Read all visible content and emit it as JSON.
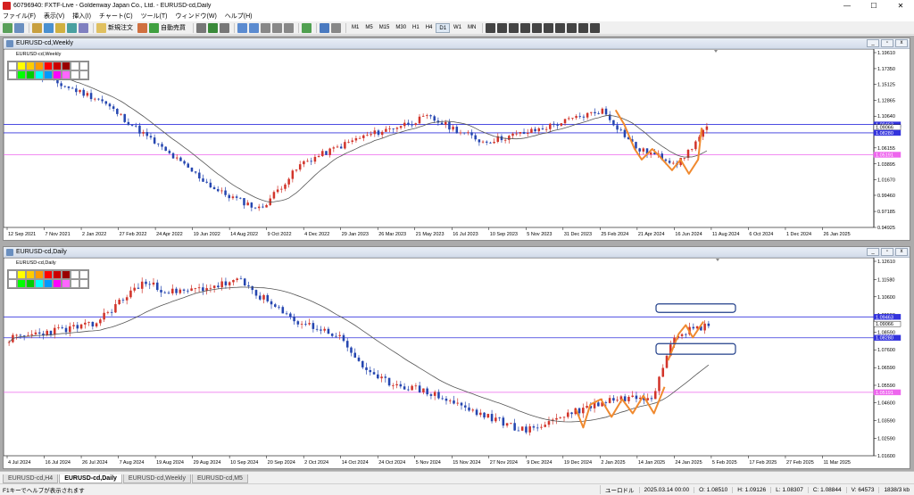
{
  "window": {
    "title": "60796940: FXTF-Live - Goldenway Japan Co., Ltd. - EURUSD-cd,Daily",
    "min": "—",
    "max": "☐",
    "close": "✕"
  },
  "menu": [
    "ファイル(F)",
    "表示(V)",
    "挿入(I)",
    "チャート(C)",
    "ツール(T)",
    "ウィンドウ(W)",
    "ヘルプ(H)"
  ],
  "toolbar": {
    "new_order": "新規注文",
    "auto_trade": "自動売買",
    "timeframes": [
      "M1",
      "M5",
      "M15",
      "M30",
      "H1",
      "H4",
      "D1",
      "W1",
      "MN"
    ],
    "active_timeframe": "D1"
  },
  "colors": {
    "bull": "#d2342a",
    "bear": "#2546b0",
    "ma": "#555555",
    "hline_blue": "#3333dd",
    "hline_pink": "#ee66ee",
    "orange": "#f08a30",
    "box": "#213f8a"
  },
  "charts": [
    {
      "name": "EURUSD-cd,Weekly",
      "label": "EURUSD-cd,Weekly",
      "y_ticks": [
        "1.19610",
        "1.17350",
        "1.15125",
        "1.12865",
        "1.10640",
        "1.08380",
        "1.06155",
        "1.03895",
        "1.01670",
        "0.99460",
        "0.97185",
        "0.94925"
      ],
      "price_tags": [
        {
          "text": "1.09463",
          "bg": "#3333dd",
          "fg": "#fff",
          "value": 1.09463
        },
        {
          "text": "1.09066",
          "bg": "#ffffff",
          "fg": "#000",
          "value": 1.09066
        },
        {
          "text": "1.08280",
          "bg": "#3333dd",
          "fg": "#fff",
          "value": 1.0828
        },
        {
          "text": "1.05191",
          "bg": "#ee66ee",
          "fg": "#fff",
          "value": 1.05191
        }
      ],
      "x_labels": [
        "12 Sep 2021",
        "7 Nov 2021",
        "2 Jan 2022",
        "27 Feb 2022",
        "24 Apr 2022",
        "19 Jun 2022",
        "14 Aug 2022",
        "9 Oct 2022",
        "4 Dec 2022",
        "29 Jan 2023",
        "26 Mar 2023",
        "21 May 2023",
        "16 Jul 2023",
        "10 Sep 2023",
        "5 Nov 2023",
        "31 Dec 2023",
        "25 Feb 2024",
        "21 Apr 2024",
        "16 Jun 2024",
        "11 Aug 2024",
        "6 Oct 2024",
        "1 Dec 2024",
        "26 Jan 2025"
      ]
    },
    {
      "name": "EURUSD-cd,Daily",
      "label": "EURUSD-cd,Daily",
      "y_ticks": [
        "1.12610",
        "1.11580",
        "1.10600",
        "1.09590",
        "1.08590",
        "1.07600",
        "1.06590",
        "1.05590",
        "1.04600",
        "1.03590",
        "1.02590",
        "1.01600"
      ],
      "price_tags": [
        {
          "text": "1.09463",
          "bg": "#3333dd",
          "fg": "#fff",
          "value": 1.09463
        },
        {
          "text": "1.09066",
          "bg": "#ffffff",
          "fg": "#000",
          "value": 1.09066
        },
        {
          "text": "1.08280",
          "bg": "#3333dd",
          "fg": "#fff",
          "value": 1.0828
        },
        {
          "text": "1.05191",
          "bg": "#ee66ee",
          "fg": "#fff",
          "value": 1.05191
        }
      ],
      "x_labels": [
        "4 Jul 2024",
        "16 Jul 2024",
        "26 Jul 2024",
        "7 Aug 2024",
        "19 Aug 2024",
        "29 Aug 2024",
        "10 Sep 2024",
        "20 Sep 2024",
        "2 Oct 2024",
        "14 Oct 2024",
        "24 Oct 2024",
        "5 Nov 2024",
        "15 Nov 2024",
        "27 Nov 2024",
        "9 Dec 2024",
        "19 Dec 2024",
        "2 Jan 2025",
        "14 Jan 2025",
        "24 Jan 2025",
        "5 Feb 2025",
        "17 Feb 2025",
        "27 Feb 2025",
        "11 Mar 2025"
      ]
    }
  ],
  "tabs": [
    {
      "label": "EURUSD-cd,H4",
      "active": false
    },
    {
      "label": "EURUSD-cd,Daily",
      "active": true
    },
    {
      "label": "EURUSD-cd,Weekly",
      "active": false
    },
    {
      "label": "EURUSD-cd,M5",
      "active": false
    }
  ],
  "status": {
    "help": "F1キーでヘルプが表示されます",
    "profile": "ユーロドル",
    "datetime": "2025.03.14 00:00",
    "open": "O: 1.08510",
    "high": "H: 1.09126",
    "low": "L: 1.08307",
    "close": "C: 1.08844",
    "volume": "V: 64573",
    "traffic": "1838/3 kb"
  }
}
